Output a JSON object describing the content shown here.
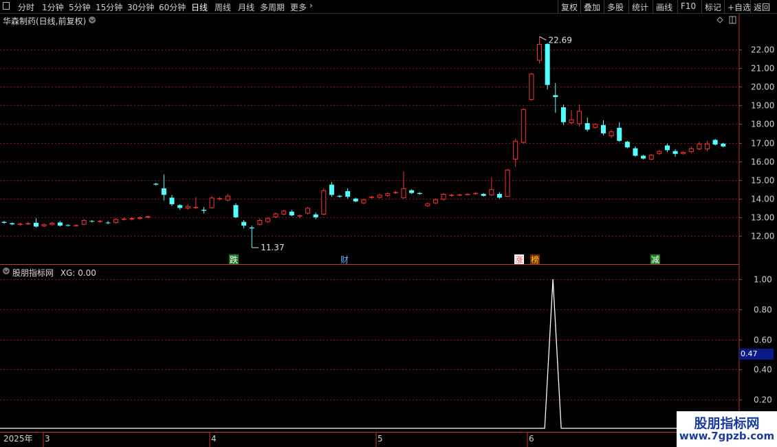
{
  "toolbar": {
    "left_items": [
      "分时",
      "1分钟",
      "5分钟",
      "15分钟",
      "30分钟",
      "60分钟",
      "日线",
      "周线",
      "月线",
      "多周期",
      "更多"
    ],
    "right_items": [
      "复权",
      "叠加",
      "多股",
      "统计",
      "画线",
      "F10",
      "标记",
      "+自选",
      "返回"
    ],
    "active": "日线",
    "more_arrow": "chevron-right-icon"
  },
  "price_panel": {
    "title": "华森制药(日线,前复权)",
    "y_ticks": [
      "22.00",
      "21.00",
      "20.00",
      "19.00",
      "18.00",
      "17.00",
      "16.00",
      "15.00",
      "14.00",
      "13.00",
      "12.00"
    ],
    "max_label": "22.69",
    "min_label": "11.37",
    "event_tags": [
      {
        "text": "跌",
        "color": "#ffffff",
        "bg": "#1e7a1e"
      },
      {
        "text": "财",
        "color": "#6ab0ff",
        "bg": "#000000"
      },
      {
        "text": "涨",
        "color": "#ff5050",
        "bg": "#ffffff"
      },
      {
        "text": "榜",
        "color": "#ffcc00",
        "bg": "#7a2a00"
      },
      {
        "text": "减",
        "color": "#ffffff",
        "bg": "#1e7a1e"
      }
    ]
  },
  "indicator_panel": {
    "title": "股朋指标网",
    "xg_label": "XG: 0.00",
    "y_ticks": [
      "1.00",
      "0.80",
      "0.60",
      "0.40",
      "0.20"
    ],
    "current_value": "0.47"
  },
  "date_axis": {
    "labels": [
      "2025年",
      "3",
      "4",
      "5",
      "6"
    ]
  },
  "watermark": {
    "line1": "股朋指标网",
    "line2": "www.7gpzb.com"
  },
  "colors": {
    "up": "#ff3232",
    "down": "#54ffff",
    "grid": "#8b1a1a",
    "axis": "#c83232",
    "indicator_line": "#ffffff"
  },
  "chart_data": {
    "type": "candlestick",
    "max_price": 22.69,
    "min_price": 11.37,
    "candles": [
      [
        12.75,
        12.7,
        12.8,
        12.65
      ],
      [
        12.68,
        12.62,
        12.72,
        12.58
      ],
      [
        12.6,
        12.65,
        12.7,
        12.55
      ],
      [
        12.62,
        12.68,
        12.75,
        12.58
      ],
      [
        12.7,
        12.5,
        12.95,
        12.45
      ],
      [
        12.52,
        12.62,
        12.68,
        12.48
      ],
      [
        12.6,
        12.7,
        12.75,
        12.55
      ],
      [
        12.72,
        12.55,
        12.8,
        12.5
      ],
      [
        12.58,
        12.56,
        12.62,
        12.5
      ],
      [
        12.55,
        12.58,
        12.62,
        12.5
      ],
      [
        12.6,
        12.85,
        12.9,
        12.58
      ],
      [
        12.8,
        12.78,
        12.85,
        12.72
      ],
      [
        12.75,
        12.8,
        12.85,
        12.7
      ],
      [
        12.72,
        12.68,
        12.8,
        12.62
      ],
      [
        12.7,
        12.9,
        12.95,
        12.65
      ],
      [
        12.88,
        12.92,
        12.98,
        12.82
      ],
      [
        12.88,
        12.95,
        13.0,
        12.82
      ],
      [
        12.92,
        13.0,
        13.05,
        12.88
      ],
      [
        12.98,
        13.05,
        13.08,
        12.95
      ],
      [
        14.8,
        14.75,
        14.85,
        14.7
      ],
      [
        14.55,
        14.2,
        15.3,
        13.9
      ],
      [
        14.05,
        13.7,
        14.2,
        13.6
      ],
      [
        13.65,
        13.5,
        13.7,
        13.4
      ],
      [
        13.48,
        13.6,
        13.7,
        13.4
      ],
      [
        13.5,
        13.55,
        14.1,
        13.45
      ],
      [
        13.4,
        13.35,
        13.55,
        13.2
      ],
      [
        13.5,
        14.05,
        14.15,
        13.45
      ],
      [
        13.98,
        14.02,
        14.1,
        13.9
      ],
      [
        13.9,
        14.15,
        14.25,
        13.85
      ],
      [
        13.65,
        13.0,
        13.75,
        12.95
      ],
      [
        12.75,
        12.55,
        12.85,
        12.4
      ],
      [
        12.45,
        12.4,
        12.55,
        11.37
      ],
      [
        12.6,
        12.85,
        12.95,
        12.55
      ],
      [
        12.75,
        12.95,
        13.0,
        12.7
      ],
      [
        13.0,
        13.2,
        13.25,
        12.95
      ],
      [
        13.15,
        13.35,
        13.4,
        13.1
      ],
      [
        13.3,
        13.1,
        13.4,
        13.05
      ],
      [
        13.05,
        13.1,
        13.15,
        12.95
      ],
      [
        13.2,
        13.5,
        13.55,
        13.15
      ],
      [
        13.15,
        13.0,
        13.25,
        12.9
      ],
      [
        13.15,
        14.45,
        14.55,
        13.1
      ],
      [
        14.75,
        14.2,
        14.9,
        14.1
      ],
      [
        14.15,
        14.1,
        14.2,
        14.05
      ],
      [
        14.4,
        14.1,
        14.55,
        14.0
      ],
      [
        14.0,
        13.85,
        14.05,
        13.8
      ],
      [
        13.75,
        13.95,
        14.0,
        13.7
      ],
      [
        14.08,
        14.1,
        14.15,
        14.0
      ],
      [
        14.05,
        14.2,
        14.25,
        14.0
      ],
      [
        14.15,
        14.28,
        14.35,
        14.1
      ],
      [
        14.3,
        14.35,
        14.4,
        14.25
      ],
      [
        14.02,
        14.55,
        15.45,
        14.0
      ],
      [
        14.45,
        14.3,
        14.5,
        14.25
      ],
      [
        14.3,
        14.25,
        14.35,
        14.2
      ],
      [
        13.6,
        13.75,
        13.8,
        13.55
      ],
      [
        13.75,
        13.95,
        14.0,
        13.7
      ],
      [
        13.95,
        14.25,
        14.3,
        13.9
      ],
      [
        14.15,
        14.2,
        14.25,
        14.1
      ],
      [
        14.18,
        14.22,
        14.26,
        14.14
      ],
      [
        14.22,
        14.25,
        14.3,
        14.18
      ],
      [
        14.3,
        14.3,
        14.35,
        14.2
      ],
      [
        14.25,
        14.15,
        14.3,
        14.1
      ],
      [
        14.18,
        14.5,
        15.15,
        14.15
      ],
      [
        14.25,
        14.05,
        14.35,
        14.0
      ],
      [
        14.1,
        15.55,
        15.6,
        14.08
      ],
      [
        16.1,
        17.1,
        17.2,
        15.7
      ],
      [
        17.0,
        18.8,
        18.85,
        16.95
      ],
      [
        19.3,
        20.7,
        20.75,
        19.25
      ],
      [
        21.4,
        22.3,
        22.69,
        21.25
      ],
      [
        22.3,
        20.1,
        22.35,
        19.85
      ],
      [
        19.55,
        19.45,
        20.2,
        18.6
      ],
      [
        18.9,
        18.1,
        19.05,
        17.95
      ],
      [
        18.05,
        18.25,
        18.75,
        18.0
      ],
      [
        18.0,
        18.7,
        19.05,
        17.85
      ],
      [
        18.05,
        17.7,
        18.35,
        17.6
      ],
      [
        17.8,
        18.0,
        18.05,
        17.75
      ],
      [
        17.95,
        17.5,
        18.2,
        17.4
      ],
      [
        17.35,
        17.6,
        17.7,
        17.25
      ],
      [
        17.8,
        17.1,
        18.1,
        17.05
      ],
      [
        17.05,
        16.75,
        17.1,
        16.7
      ],
      [
        16.7,
        16.3,
        16.8,
        16.25
      ],
      [
        16.3,
        16.15,
        16.35,
        16.1
      ],
      [
        16.1,
        16.35,
        16.4,
        16.05
      ],
      [
        16.4,
        16.55,
        16.6,
        16.35
      ],
      [
        16.85,
        16.6,
        16.95,
        16.5
      ],
      [
        16.55,
        16.4,
        16.65,
        16.25
      ],
      [
        16.4,
        16.5,
        16.55,
        16.35
      ],
      [
        16.5,
        16.7,
        16.8,
        16.45
      ],
      [
        16.65,
        16.95,
        17.05,
        16.6
      ],
      [
        16.65,
        16.95,
        17.1,
        16.55
      ],
      [
        17.15,
        16.9,
        17.2,
        16.85
      ],
      [
        16.95,
        16.8,
        17.0,
        16.75
      ]
    ],
    "xg_series": {
      "name": "XG",
      "peak_index": 68,
      "peak_value": 1.0,
      "baseline": 0.0
    }
  }
}
